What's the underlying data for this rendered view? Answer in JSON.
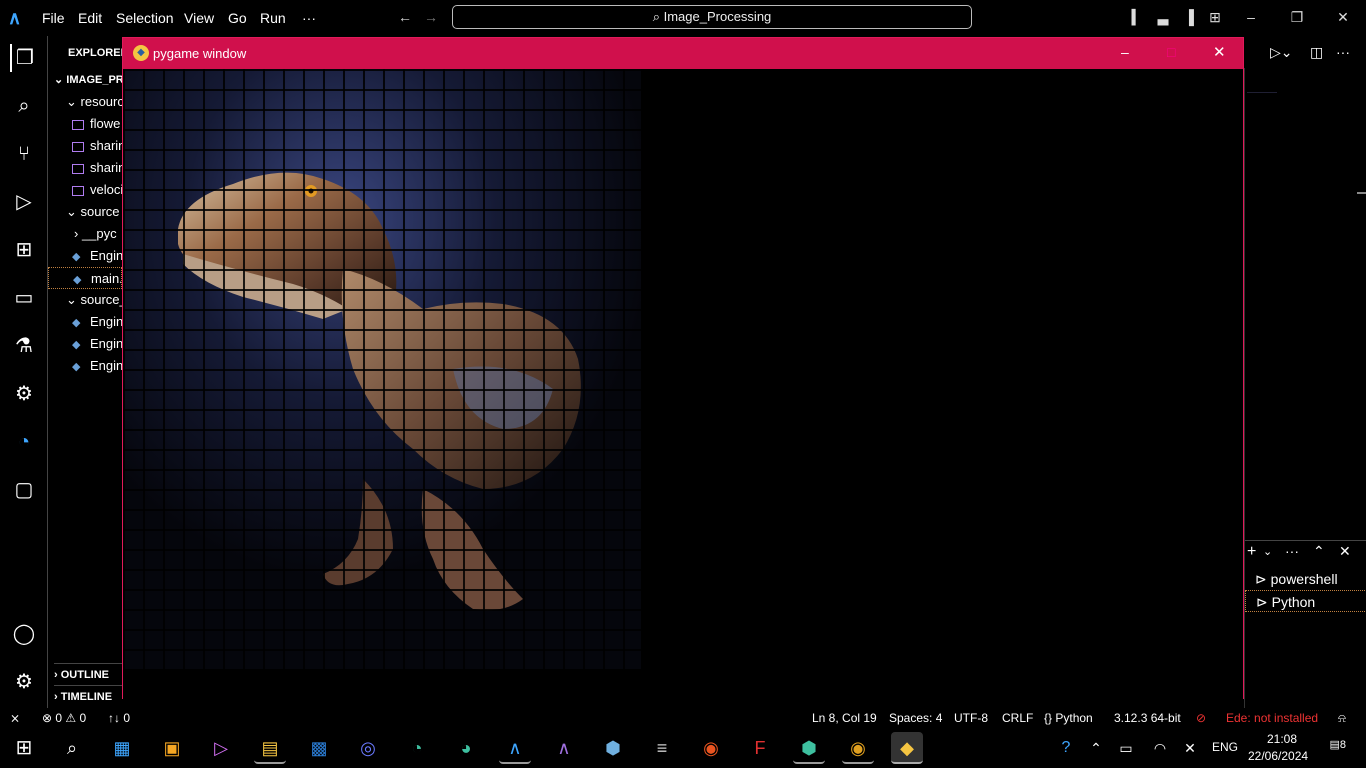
{
  "titlebar": {
    "menu": [
      "File",
      "Edit",
      "Selection",
      "View",
      "Go",
      "Run",
      "···"
    ],
    "search_text": "Image_Processing"
  },
  "sidebar": {
    "title": "EXPLORER",
    "root": "IMAGE_PR",
    "items": [
      {
        "label": "resourc",
        "type": "folder"
      },
      {
        "label": "flowe",
        "type": "image"
      },
      {
        "label": "sharin",
        "type": "image"
      },
      {
        "label": "sharin",
        "type": "image"
      },
      {
        "label": "veloci",
        "type": "image"
      },
      {
        "label": "source",
        "type": "folder"
      },
      {
        "label": "__pyc",
        "type": "folder-collapsed"
      },
      {
        "label": "Engin",
        "type": "python"
      },
      {
        "label": "main.",
        "type": "python"
      },
      {
        "label": "source_",
        "type": "folder"
      },
      {
        "label": "Engin",
        "type": "python"
      },
      {
        "label": "Engin",
        "type": "python"
      },
      {
        "label": "Engin",
        "type": "python"
      }
    ],
    "outline": "OUTLINE",
    "timeline": "TIMELINE"
  },
  "pygame": {
    "title": "pygame window"
  },
  "terminal": {
    "tabs": [
      "powershell",
      "Python"
    ]
  },
  "statusbar": {
    "errors": "0",
    "warnings": "0",
    "ports": "0",
    "position": "Ln 8, Col 19",
    "spaces": "Spaces: 4",
    "encoding": "UTF-8",
    "eol": "CRLF",
    "language": "Python",
    "interpreter": "3.12.3 64-bit",
    "lint": "Ede: not installed"
  },
  "taskbar": {
    "lang": "ENG",
    "time": "21:08",
    "date": "22/06/2024",
    "notifications": "8"
  },
  "colors": {
    "pygame_title": "#d0104c",
    "accent": "#e01a5a"
  }
}
